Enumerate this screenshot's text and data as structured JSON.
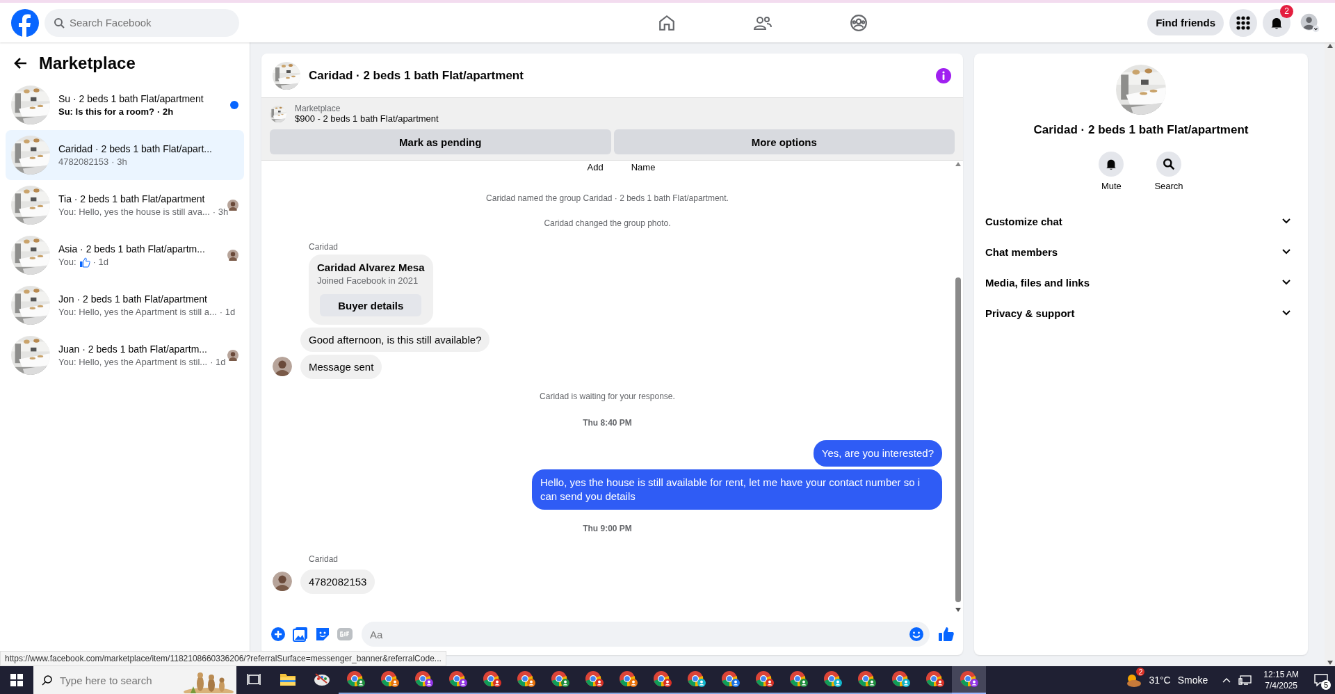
{
  "top_bar": {
    "search": {
      "placeholder": "Search Facebook"
    },
    "nav": [
      {
        "kind": "home"
      },
      {
        "kind": "friends"
      },
      {
        "kind": "groups"
      }
    ],
    "find_friends": "Find friends",
    "notifications_badge": "2"
  },
  "sidebar": {
    "title": "Marketplace",
    "conversations": [
      {
        "title": "Su · 2 beds 1 bath Flat/apartment",
        "preview": "Su: Is this for a room?",
        "time": "· 2h",
        "kind": "text",
        "unread": true,
        "seen": false,
        "selected": false
      },
      {
        "title": "Caridad · 2 beds 1 bath Flat/apart...",
        "preview": "4782082153",
        "time": "· 3h",
        "kind": "text",
        "unread": false,
        "seen": false,
        "selected": true
      },
      {
        "title": "Tia · 2 beds 1 bath Flat/apartment",
        "preview": "You: Hello, yes the house is still ava...",
        "time": "· 3h",
        "kind": "text",
        "unread": false,
        "seen": true,
        "selected": false
      },
      {
        "title": "Asia · 2 beds 1 bath Flat/apartm...",
        "preview": "You:",
        "time": "· 1d",
        "kind": "like",
        "unread": false,
        "seen": true,
        "selected": false
      },
      {
        "title": "Jon · 2 beds 1 bath Flat/apartment",
        "preview": "You: Hello, yes the Apartment is still a...",
        "time": "· 1d",
        "kind": "text",
        "unread": false,
        "seen": false,
        "selected": false
      },
      {
        "title": "Juan · 2 beds 1 bath Flat/apartm...",
        "preview": "You: Hello, yes the Apartment is stil...",
        "time": "· 1d",
        "kind": "text",
        "unread": false,
        "seen": true,
        "selected": false
      }
    ]
  },
  "chat": {
    "title": "Caridad · 2 beds 1 bath Flat/apartment",
    "listing": {
      "source": "Marketplace",
      "title": "$900 - 2 beds 1 bath Flat/apartment"
    },
    "buttons": [
      "Mark as pending",
      "More options"
    ],
    "messages": [
      {
        "kind": "labels",
        "items": [
          "Add",
          "Name"
        ]
      },
      {
        "kind": "system",
        "text": "Caridad named the group Caridad · 2 beds 1 bath Flat/apartment."
      },
      {
        "kind": "system",
        "text": "Caridad changed the group photo."
      },
      {
        "kind": "sender",
        "text": "Caridad"
      },
      {
        "kind": "profile_card",
        "name": "Caridad Alvarez Mesa",
        "subtitle": "Joined Facebook in 2021",
        "button": "Buyer details"
      },
      {
        "kind": "incoming",
        "text": "Good afternoon, is this still available?",
        "avatar": false
      },
      {
        "kind": "incoming",
        "text": "Message sent",
        "avatar": true
      },
      {
        "kind": "system",
        "text": "Caridad is waiting for your response."
      },
      {
        "kind": "time",
        "text": "Thu 8:40 PM"
      },
      {
        "kind": "outgoing",
        "text": "Yes, are you interested?"
      },
      {
        "kind": "outgoing",
        "text": "Hello, yes the house is still available for rent, let me have your contact number so i can send you details"
      },
      {
        "kind": "time",
        "text": "Thu 9:00 PM"
      },
      {
        "kind": "sender",
        "text": "Caridad"
      },
      {
        "kind": "incoming",
        "text": "4782082153",
        "avatar": true
      }
    ],
    "composer": {
      "placeholder": "Aa"
    }
  },
  "details": {
    "title": "Caridad · 2 beds 1 bath Flat/apartment",
    "actions": [
      {
        "kind": "bell",
        "label": "Mute"
      },
      {
        "kind": "search",
        "label": "Search"
      }
    ],
    "sections": [
      {
        "label": "Customize chat",
        "expanded": false
      },
      {
        "label": "Chat members",
        "expanded": false
      },
      {
        "label": "Media, files and links",
        "expanded": false
      },
      {
        "label": "Privacy & support",
        "expanded": false
      }
    ]
  },
  "status_url": "https://www.facebook.com/marketplace/item/1182108660336206/?referralSurface=messenger_banner&referralCode...",
  "taskbar": {
    "search": {
      "placeholder": "Type here to search"
    },
    "apps": [
      {
        "kind": "taskview",
        "selected": false
      },
      {
        "kind": "explorer",
        "selected": false
      },
      {
        "kind": "paint",
        "selected": false
      },
      {
        "kind": "chrome",
        "color": "#1e8e3e",
        "selected": false
      },
      {
        "kind": "chrome",
        "color": "#e8710a",
        "selected": false
      },
      {
        "kind": "chrome",
        "color": "#9334e6",
        "selected": false
      },
      {
        "kind": "chrome",
        "color": "#9334e6",
        "selected": false
      },
      {
        "kind": "chrome",
        "color": "#d93025",
        "selected": false
      },
      {
        "kind": "chrome",
        "color": "#e8710a",
        "selected": false
      },
      {
        "kind": "chrome",
        "color": "#1e8e3e",
        "selected": false
      },
      {
        "kind": "chrome",
        "color": "#d93025",
        "selected": false
      },
      {
        "kind": "chrome",
        "color": "#e8710a",
        "selected": false
      },
      {
        "kind": "chrome",
        "color": "#d93025",
        "selected": false
      },
      {
        "kind": "chrome",
        "color": "#12b5cb",
        "selected": false
      },
      {
        "kind": "chrome",
        "color": "#1a73e8",
        "selected": false
      },
      {
        "kind": "chrome",
        "color": "#d93025",
        "selected": false
      },
      {
        "kind": "chrome",
        "color": "#1e8e3e",
        "selected": false
      },
      {
        "kind": "chrome",
        "color": "#12b5cb",
        "selected": false
      },
      {
        "kind": "chrome",
        "color": "#1e8e3e",
        "selected": false
      },
      {
        "kind": "chrome",
        "color": "#12b5cb",
        "selected": false
      },
      {
        "kind": "chrome",
        "color": "#d93025",
        "selected": false
      },
      {
        "kind": "chrome",
        "color": "#9334e6",
        "selected": true
      }
    ],
    "weather_badge": "2",
    "temperature": "31°C",
    "condition": "Smoke",
    "time": "12:15 AM",
    "date": "7/4/2025",
    "notifications": "5"
  }
}
